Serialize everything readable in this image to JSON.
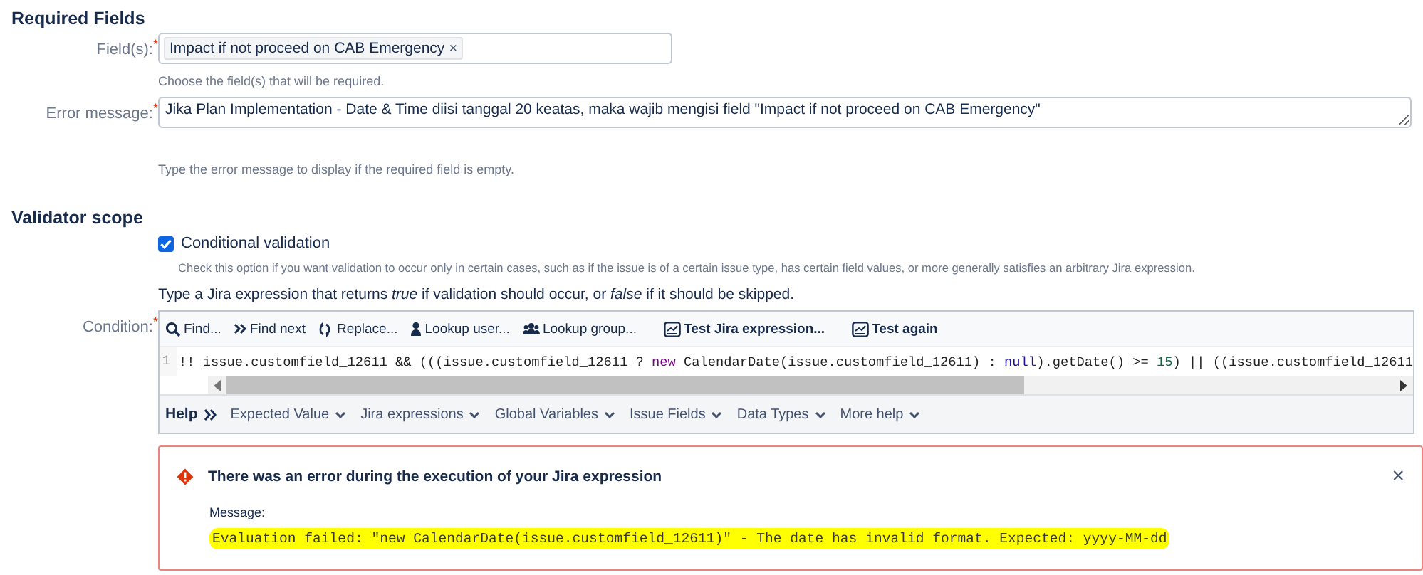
{
  "required_fields": {
    "heading": "Required Fields",
    "rows": [
      {
        "kind": "tags",
        "label": "Field(s):",
        "required_mark": "*",
        "tags": [
          {
            "label": "Impact if not proceed on CAB Emergency",
            "remove": "×"
          }
        ],
        "hint": "Choose the field(s) that will be required."
      },
      {
        "kind": "textarea",
        "label": "Error message:",
        "required_mark": "*",
        "value": "Jika Plan Implementation - Date & Time diisi tanggal 20 keatas, maka wajib mengisi field \"Impact if not proceed on CAB Emergency\"",
        "hint": "Type the error message to display if the required field is empty."
      }
    ]
  },
  "validator_scope": {
    "heading": "Validator scope",
    "checkbox": {
      "label": "Conditional validation",
      "checked": true,
      "description": "Check this option if you want validation to occur only in certain cases, such as if the issue is of a certain issue type, has certain field values, or more generally satisfies an arbitrary Jira expression."
    },
    "instruction": "Type a Jira expression that returns *true* if validation should occur, or *false* if it should be skipped.",
    "condition": {
      "label": "Condition:",
      "required_mark": "*",
      "toolbar": [
        {
          "kind": "tool",
          "label": "Find..."
        },
        {
          "kind": "tool",
          "label": "Find next"
        },
        {
          "kind": "tool",
          "label": "Replace..."
        },
        {
          "kind": "tool",
          "label": "Lookup user..."
        },
        {
          "kind": "tool",
          "label": "Lookup group..."
        },
        {
          "kind": "action",
          "label": "Test Jira expression..."
        },
        {
          "kind": "action",
          "label": "Test again"
        }
      ],
      "line_number": "1",
      "code": [
        {
          "kind": "plain",
          "text": "!! issue.customfield_12611 && (((issue.customfield_12611 ? "
        },
        {
          "kind": "keyword",
          "text": "new"
        },
        {
          "kind": "plain",
          "text": " CalendarDate(issue.customfield_12611) : "
        },
        {
          "kind": "literal",
          "text": "null"
        },
        {
          "kind": "plain",
          "text": ").getDate() >= "
        },
        {
          "kind": "number",
          "text": "15"
        },
        {
          "kind": "plain",
          "text": ") || ((issue.customfield_12611"
        }
      ],
      "help_label": "Help",
      "help_menus": [
        "Expected Value",
        "Jira expressions",
        "Global Variables",
        "Issue Fields",
        "Data Types",
        "More help"
      ]
    }
  },
  "error_panel": {
    "title": "There was an error during the execution of your Jira expression",
    "close": "×",
    "message_label": "Message:",
    "message": "Evaluation failed: \"new CalendarDate(issue.customfield_12611)\" - The date has invalid format. Expected: yyyy-MM-dd",
    "highlighted": true
  }
}
